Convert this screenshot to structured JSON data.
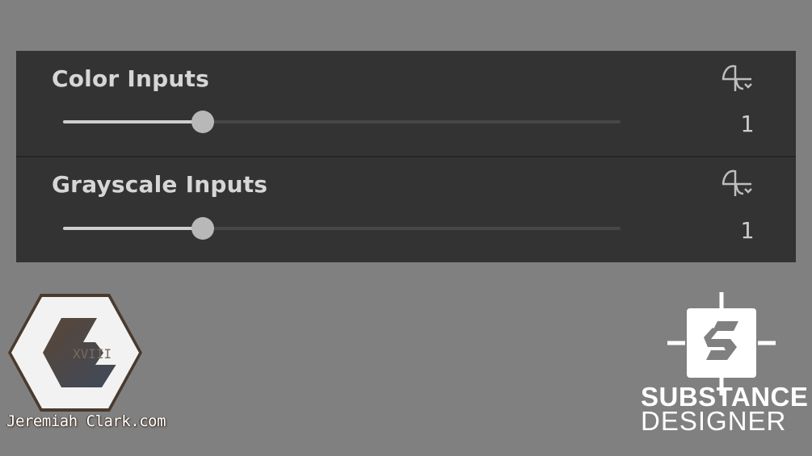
{
  "parameters": [
    {
      "label": "Color Inputs",
      "value": "1",
      "slider_fraction": 0.25
    },
    {
      "label": "Grayscale Inputs",
      "value": "1",
      "slider_fraction": 0.25
    }
  ],
  "icons": {
    "function_menu": "function-graph-dropdown-icon",
    "jc_logo": "hexagon-c-logo-icon",
    "sd_logo": "substance-designer-logo-icon"
  },
  "branding": {
    "watermark": "Jeremiah Clark.com",
    "watermark_logo_text": "XVIII",
    "product_line1": "SUBSTANCE",
    "product_line2": "DESIGNER"
  },
  "colors": {
    "background": "#808080",
    "panel": "#333333",
    "label": "#d6d6d6",
    "slider_fill": "#cfcfcf",
    "slider_track": "#474747",
    "thumb": "#b8b8b8"
  }
}
